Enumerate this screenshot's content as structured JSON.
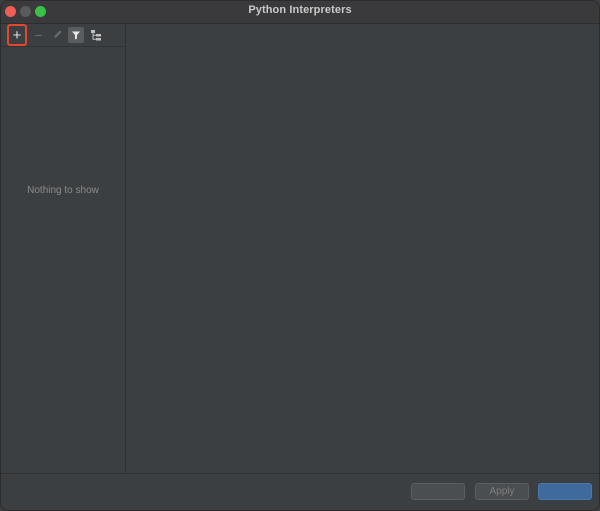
{
  "window": {
    "title": "Python Interpreters"
  },
  "toolbar": {
    "add_icon": "plus-icon",
    "remove_icon": "minus-icon",
    "edit_icon": "pencil-icon",
    "filter_icon": "filter-icon",
    "tree_icon": "tree-icon"
  },
  "list": {
    "empty_text": "Nothing to show"
  },
  "footer": {
    "cancel_label": "",
    "apply_label": "Apply",
    "ok_label": ""
  },
  "colors": {
    "background": "#3c3f41",
    "highlight_border": "#e2472f",
    "ok_button": "#3e6a9e"
  }
}
